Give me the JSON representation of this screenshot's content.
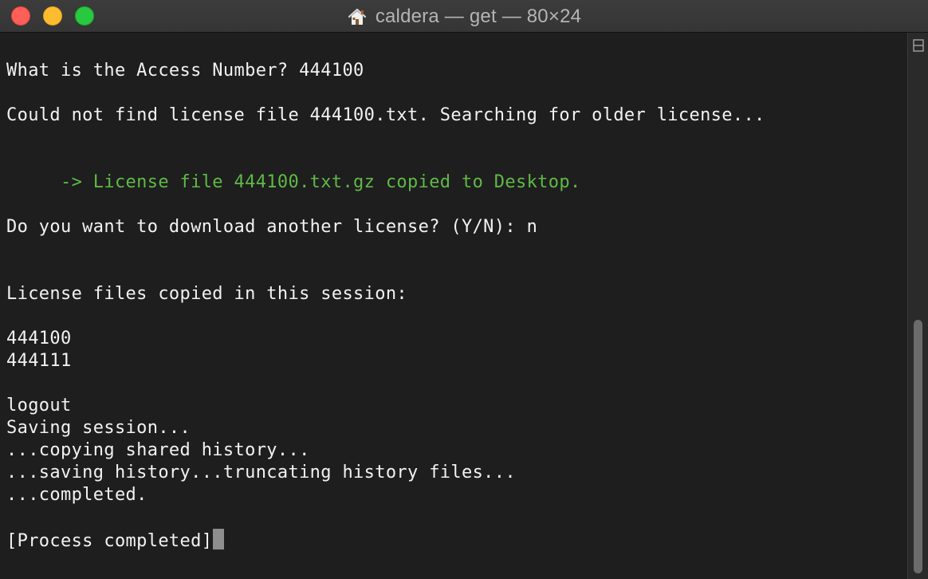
{
  "window": {
    "title": "caldera — get — 80×24"
  },
  "terminal": {
    "lines": [
      "What is the Access Number? 444100",
      "Could not find license file 444100.txt. Searching for older license...",
      "     -> License file 444100.txt.gz copied to Desktop.",
      "Do you want to download another license? (Y/N): n",
      "License files copied in this session:",
      "444100",
      "444111",
      "logout",
      "Saving session...",
      "...copying shared history...",
      "...saving history...truncating history files...",
      "...completed.",
      "[Process completed]"
    ]
  },
  "colors": {
    "background": "#1e1e1e",
    "text": "#f2f2f2",
    "success_text": "#5fb947",
    "close": "#fe5f57",
    "minimize": "#febc2e",
    "zoom": "#28c840"
  },
  "icons": {
    "title": "home-icon",
    "scrollbar": "split-pane-icon"
  }
}
